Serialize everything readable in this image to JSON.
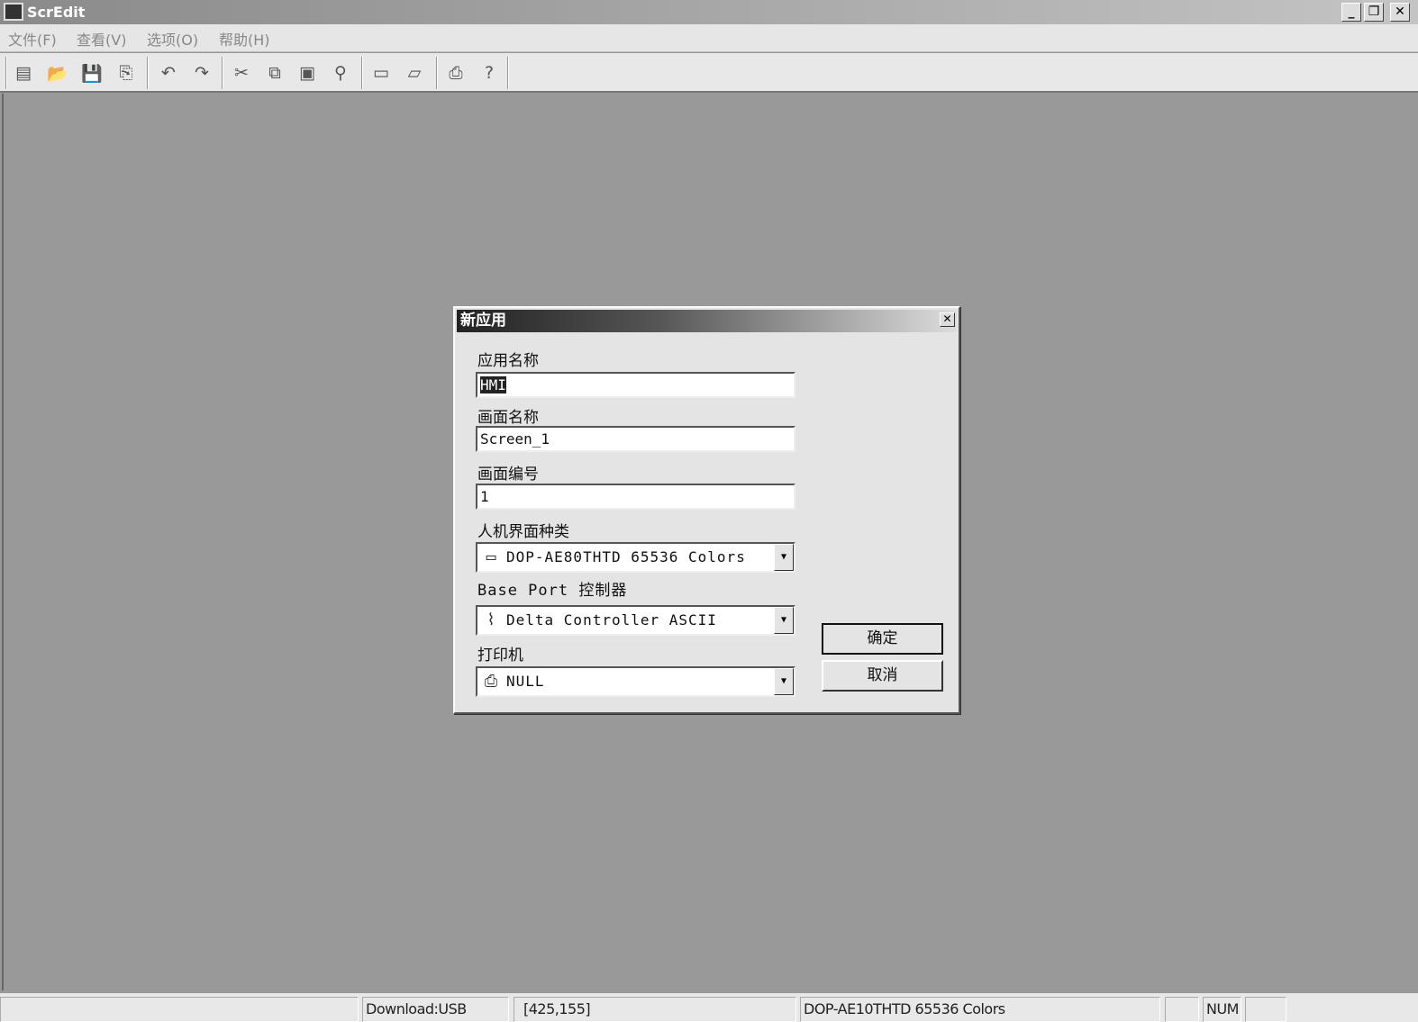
{
  "window": {
    "title": "ScrEdit",
    "minimize": "_",
    "restore": "❐",
    "close": "✕"
  },
  "menu": [
    "文件(F)",
    "查看(V)",
    "选项(O)",
    "帮助(H)"
  ],
  "toolbar": [
    {
      "name": "new-file-icon",
      "glyph": "▤"
    },
    {
      "name": "open-icon",
      "glyph": "📂"
    },
    {
      "name": "save-icon",
      "glyph": "💾"
    },
    {
      "name": "save-as-icon",
      "glyph": "⎘"
    },
    {
      "name": "undo-icon",
      "glyph": "↶"
    },
    {
      "name": "redo-icon",
      "glyph": "↷"
    },
    {
      "name": "cut-icon",
      "glyph": "✂"
    },
    {
      "name": "copy-icon",
      "glyph": "⧉"
    },
    {
      "name": "paste-icon",
      "glyph": "▣"
    },
    {
      "name": "find-icon",
      "glyph": "⚲"
    },
    {
      "name": "new-screen-icon",
      "glyph": "▭"
    },
    {
      "name": "open-screen-icon",
      "glyph": "▱"
    },
    {
      "name": "print-icon",
      "glyph": "⎙"
    },
    {
      "name": "help-icon",
      "glyph": "?"
    }
  ],
  "dialog": {
    "title": "新应用",
    "close": "✕",
    "app_name_label": "应用名称",
    "app_name_value": "HMI",
    "screen_name_label": "画面名称",
    "screen_name_value": "Screen_1",
    "screen_no_label": "画面编号",
    "screen_no_value": "1",
    "hmi_type_label": "人机界面种类",
    "hmi_type_value": "DOP-AE80THTD 65536 Colors",
    "controller_label": "Base Port 控制器",
    "controller_value": "Delta Controller ASCII",
    "printer_label": "打印机",
    "printer_value": "NULL",
    "ok": "确定",
    "cancel": "取消"
  },
  "status": {
    "pane1": "",
    "download": "Download:USB",
    "coords": "[425,155]",
    "model": "DOP-AE10THTD 65536 Colors",
    "pane5": "",
    "num": "NUM",
    "pane7": ""
  }
}
